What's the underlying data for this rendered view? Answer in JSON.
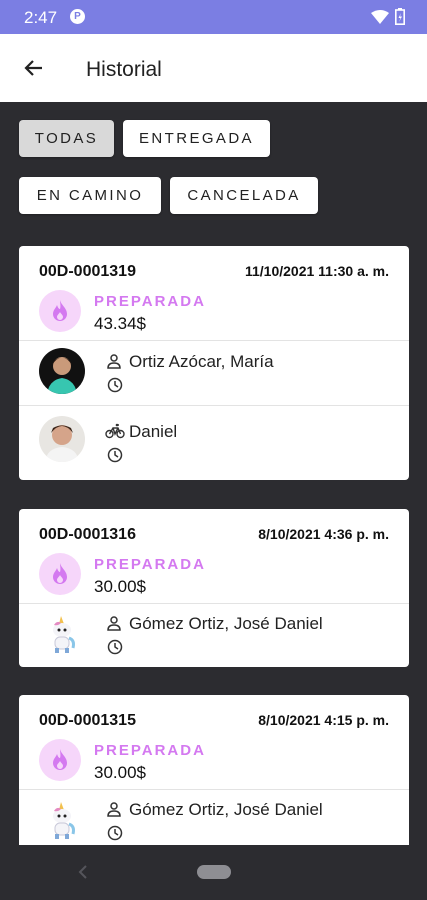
{
  "status_bar": {
    "time": "2:47",
    "app_badge": "P"
  },
  "app_bar": {
    "title": "Historial"
  },
  "filters": [
    {
      "label": "TODAS",
      "active": true
    },
    {
      "label": "ENTREGADA",
      "active": false
    },
    {
      "label": "EN CAMINO",
      "active": false
    },
    {
      "label": "CANCELADA",
      "active": false
    }
  ],
  "orders": [
    {
      "id": "00D-0001319",
      "date": "11/10/2021 11:30 a. m.",
      "status": "PREPARADA",
      "price": "43.34$",
      "customer": "Ortiz Azócar, María",
      "courier": "Daniel"
    },
    {
      "id": "00D-0001316",
      "date": "8/10/2021 4:36 p. m.",
      "status": "PREPARADA",
      "price": "30.00$",
      "customer": "Gómez Ortiz, José Daniel"
    },
    {
      "id": "00D-0001315",
      "date": "8/10/2021 4:15 p. m.",
      "status": "PREPARADA",
      "price": "30.00$",
      "customer": "Gómez Ortiz, José Daniel"
    }
  ],
  "colors": {
    "status_bar": "#7b7ee3",
    "background": "#2c2c30",
    "status_accent": "#d479f0",
    "icon_circle": "#f6d6fa"
  },
  "icons": [
    "back-arrow-icon",
    "person-icon",
    "clock-icon",
    "bicycle-icon",
    "flame-icon",
    "wifi-icon",
    "battery-icon"
  ]
}
